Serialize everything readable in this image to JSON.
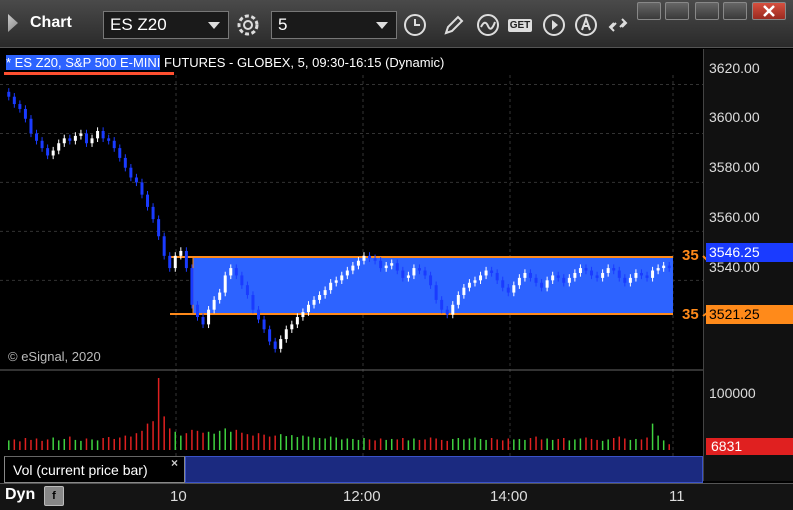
{
  "app": {
    "title": "Chart"
  },
  "toolbar": {
    "symbol": "ES Z20",
    "interval": "5",
    "icons": [
      "settings-gear-icon",
      "clock-icon",
      "draw-pencil-icon",
      "study-wave-icon",
      "get-icon",
      "play-icon",
      "alert-a-icon",
      "link-icon"
    ],
    "get_text": "GET"
  },
  "chart": {
    "title_selected": "* ES Z20, S&P 500 E-MINI",
    "title_rest": " FUTURES - GLOBEX, 5, 09:30-16:15 (Dynamic)",
    "copyright": "© eSignal, 2020",
    "price_labels": [
      "3620.00",
      "3600.00",
      "3580.00",
      "3560.00",
      "3540.00"
    ],
    "zone_high": "3546.25",
    "zone_low": "3521.25",
    "zone_high_cut": "35",
    "zone_low_cut": "35",
    "vol_max_label": "100000",
    "vol_current": "6831",
    "time_labels": [
      "10",
      "12:00",
      "14:00",
      "11"
    ]
  },
  "indicator": {
    "label": "Vol (current price bar)",
    "close": "×"
  },
  "bottom": {
    "dyn_label": "Dyn",
    "dyn_button": "f"
  },
  "colors": {
    "zone": "#2d63ff",
    "zone_line": "#ff8a1a",
    "up_candle": "#ffffff",
    "down_candle": "#1a3bff"
  },
  "chart_data": {
    "type": "candlestick",
    "title": "ES Z20, S&P 500 E-MINI FUTURES - GLOBEX, 5, 09:30-16:15 (Dynamic)",
    "ylim": [
      3505,
      3630
    ],
    "zone": [
      3521.25,
      3546.25
    ],
    "closes": [
      3615,
      3612,
      3610,
      3606,
      3600,
      3597,
      3594,
      3591,
      3593,
      3596,
      3598,
      3597,
      3599,
      3600,
      3596,
      3598,
      3601,
      3598,
      3597,
      3594,
      3590,
      3586,
      3582,
      3580,
      3575,
      3570,
      3565,
      3558,
      3550,
      3545,
      3550,
      3552,
      3545,
      3530,
      3525,
      3522,
      3528,
      3532,
      3535,
      3542,
      3545,
      3542,
      3538,
      3534,
      3528,
      3524,
      3520,
      3515,
      3512,
      3516,
      3520,
      3522,
      3525,
      3527,
      3530,
      3532,
      3534,
      3536,
      3539,
      3540,
      3542,
      3544,
      3546,
      3548,
      3550,
      3549,
      3548,
      3545,
      3546,
      3547,
      3544,
      3541,
      3542,
      3545,
      3544,
      3542,
      3538,
      3532,
      3528,
      3526,
      3530,
      3534,
      3537,
      3539,
      3540,
      3542,
      3544,
      3543,
      3540,
      3537,
      3535,
      3538,
      3541,
      3543,
      3541,
      3539,
      3537,
      3540,
      3542,
      3541,
      3539,
      3541,
      3543,
      3545,
      3544,
      3542,
      3541,
      3543,
      3545,
      3544,
      3541,
      3539,
      3541,
      3543,
      3542,
      3541,
      3544,
      3545,
      3546,
      3545
    ],
    "volume": [
      20,
      22,
      18,
      25,
      21,
      24,
      19,
      22,
      26,
      20,
      23,
      28,
      21,
      19,
      24,
      22,
      20,
      25,
      27,
      23,
      26,
      30,
      28,
      35,
      40,
      55,
      60,
      150,
      70,
      45,
      38,
      30,
      35,
      42,
      40,
      36,
      38,
      34,
      40,
      45,
      38,
      42,
      36,
      33,
      30,
      35,
      32,
      28,
      30,
      33,
      29,
      31,
      27,
      30,
      28,
      26,
      25,
      24,
      28,
      26,
      22,
      24,
      23,
      21,
      25,
      22,
      20,
      24,
      21,
      23,
      22,
      25,
      20,
      24,
      21,
      22,
      26,
      24,
      21,
      19,
      23,
      25,
      22,
      24,
      26,
      23,
      21,
      25,
      22,
      20,
      24,
      22,
      23,
      21,
      25,
      28,
      22,
      24,
      21,
      23,
      25,
      20,
      22,
      24,
      26,
      23,
      21,
      19,
      22,
      25,
      28,
      24,
      21,
      23,
      22,
      26,
      55,
      30,
      20,
      12
    ]
  }
}
